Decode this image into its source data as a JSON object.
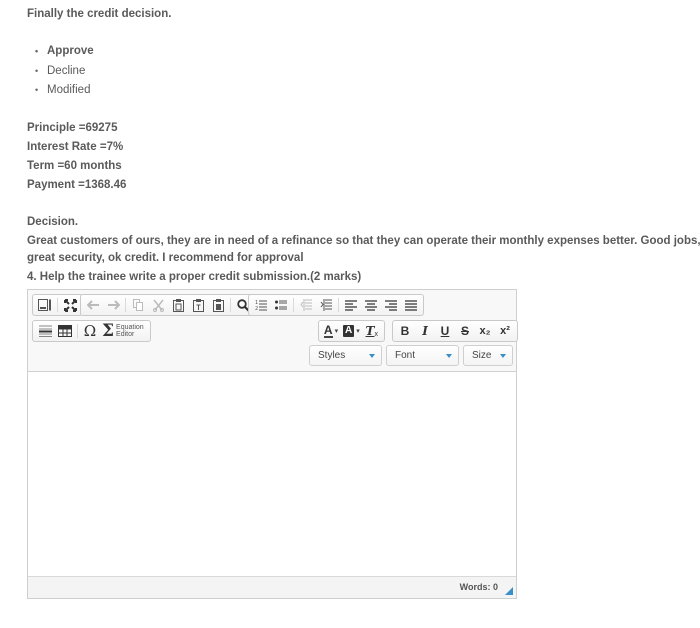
{
  "heading": "Finally the credit decision.",
  "options": [
    "Approve",
    "Decline",
    "Modified"
  ],
  "loan": {
    "principle": "Principle  =69275",
    "interest_rate": "Interest Rate  =7%",
    "term": "Term   =60 months",
    "payment": "Payment =1368.46"
  },
  "decision_label": "Decision.",
  "decision_text_line1": "Great customers of ours, they are in need of a refinance so that they can operate their monthly expenses better. Good jobs,",
  "decision_text_line2": "great security, ok credit. I recommend for approval",
  "question": "4. Help the trainee write a proper credit submission.(2 marks)",
  "editor": {
    "toolbar": {
      "equation_editor_line1": "Equation",
      "equation_editor_line2": "Editor",
      "styles_label": "Styles",
      "font_label": "Font",
      "size_label": "Size",
      "bold": "B",
      "italic": "I",
      "underline": "U",
      "strike": "S",
      "subscript": "x₂",
      "superscript": "x²",
      "text_color": "A",
      "bg_color": "A",
      "remove_format": "T"
    },
    "content": "",
    "word_count": "Words: 0"
  },
  "colors": {
    "accent": "#3a8fc8",
    "text": "#5a5a5a"
  }
}
